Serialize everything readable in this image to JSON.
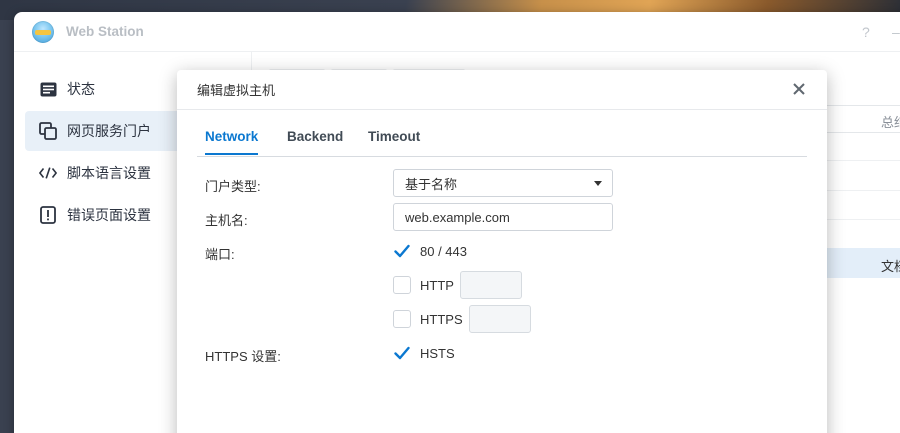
{
  "app": {
    "title": "Web Station",
    "help": "?",
    "minimize": "–"
  },
  "sidebar": {
    "items": [
      {
        "label": "状态",
        "icon": "status-list-icon"
      },
      {
        "label": "网页服务门户",
        "icon": "web-portal-icon",
        "active": true
      },
      {
        "label": "脚本语言设置",
        "icon": "code-icon"
      },
      {
        "label": "错误页面设置",
        "icon": "error-page-icon"
      }
    ]
  },
  "background": {
    "column_header": "总结",
    "row_cell": "文档"
  },
  "dialog": {
    "title": "编辑虚拟主机",
    "tabs": [
      "Network",
      "Backend",
      "Timeout"
    ],
    "active_tab": "Network",
    "fields": {
      "portal_type_label": "门户类型:",
      "portal_type_value": "基于名称",
      "hostname_label": "主机名:",
      "hostname_value": "web.example.com",
      "port_label": "端口:",
      "port_default": "80 / 443",
      "port_http": "HTTP",
      "port_https": "HTTPS",
      "https_settings_label": "HTTPS 设置:",
      "hsts": "HSTS"
    },
    "checkboxes": {
      "default_ports": true,
      "http": false,
      "https": false,
      "hsts": true
    }
  },
  "colors": {
    "accent": "#0b78d0",
    "active_nav_bg": "#e8f0f8"
  }
}
